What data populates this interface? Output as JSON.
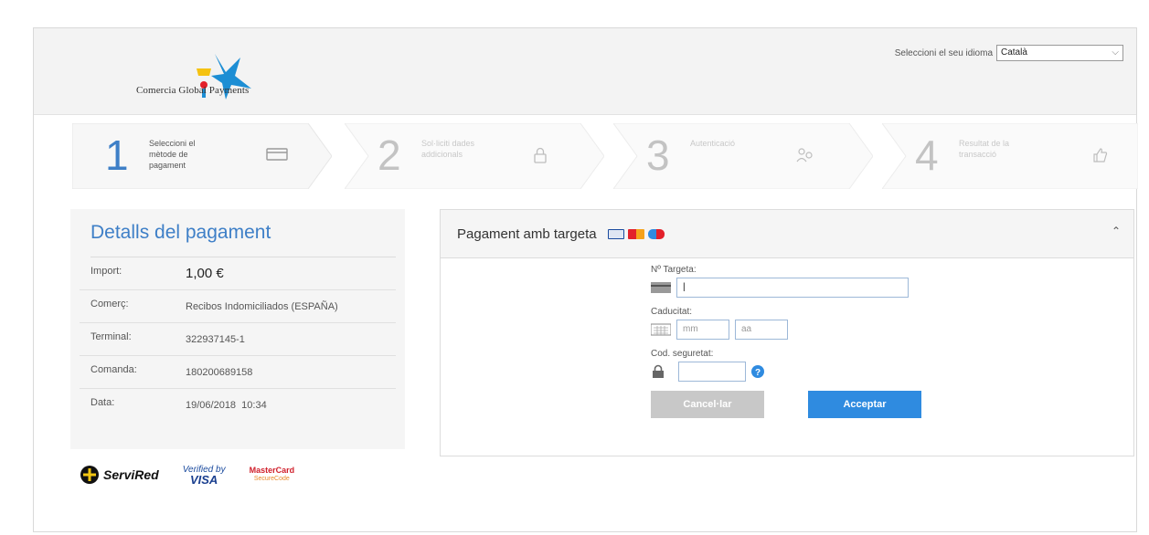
{
  "header": {
    "logo_text": "Comercia Global Payments",
    "language_label": "Seleccioni el seu idioma",
    "language_selected": "Català"
  },
  "steps": [
    {
      "number": "1",
      "label": "Seleccioni el mètode de pagament",
      "state": "active"
    },
    {
      "number": "2",
      "label": "Sol·liciti dades addicionals",
      "state": "inactive"
    },
    {
      "number": "3",
      "label": "Autenticació",
      "state": "inactive"
    },
    {
      "number": "4",
      "label": "Resultat de la transacció",
      "state": "inactive"
    }
  ],
  "details": {
    "title": "Detalls del pagament",
    "rows": [
      {
        "key": "Import:",
        "value": "1,00 €"
      },
      {
        "key": "Comerç:",
        "value": "Recibos Indomiciliados (ESPAÑA)"
      },
      {
        "key": "Terminal:",
        "value": "322937145-1"
      },
      {
        "key": "Comanda:",
        "value": "180200689158"
      },
      {
        "key": "Data:",
        "value": "19/06/2018  10:34"
      }
    ]
  },
  "badges": {
    "servired": "ServiRed",
    "vbv_top": "Verified by",
    "vbv_bottom": "VISA",
    "mc_top": "MasterCard",
    "mc_bottom": "SecureCode"
  },
  "payment": {
    "title": "Pagament amb targeta",
    "card_number_label": "Nº Targeta:",
    "expiry_label": "Caducitat:",
    "expiry_month_placeholder": "mm",
    "expiry_year_placeholder": "aa",
    "cvv_label": "Cod. seguretat:",
    "cancel_label": "Cancel·lar",
    "accept_label": "Acceptar"
  },
  "colors": {
    "accent": "#3e7fc7",
    "button_primary": "#2f8be0",
    "button_disabled": "#c8c8c8"
  }
}
